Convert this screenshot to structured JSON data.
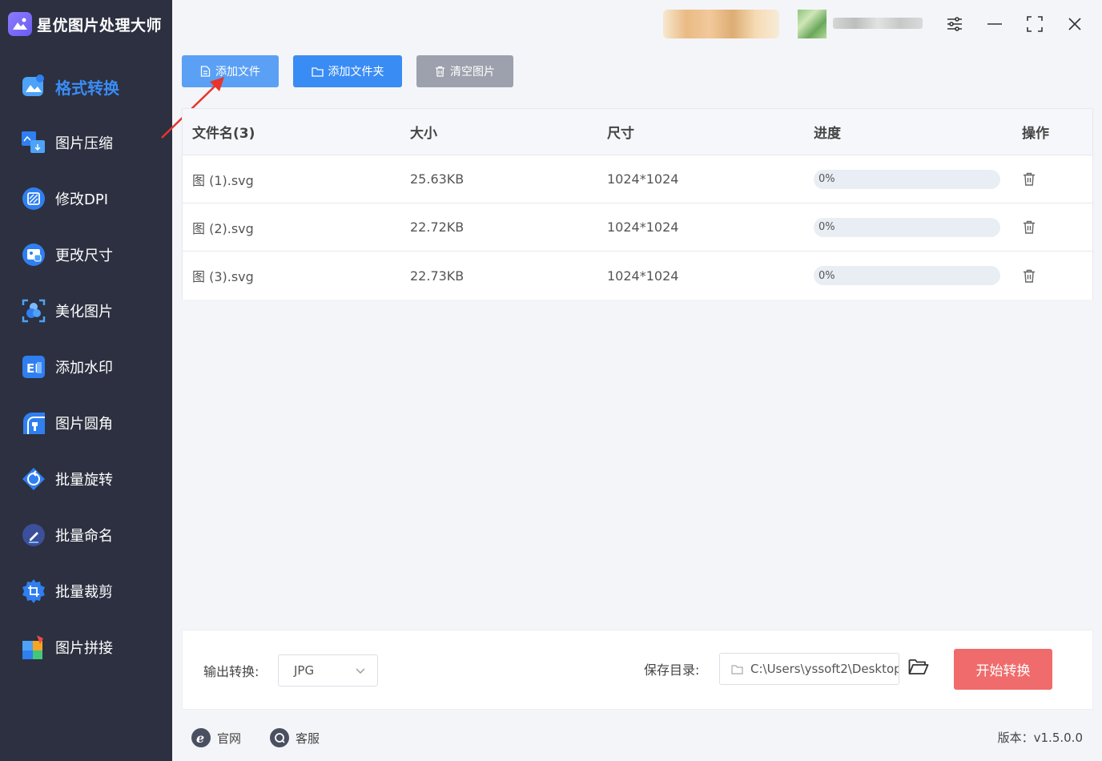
{
  "app": {
    "title": "星优图片处理大师"
  },
  "sidebar": {
    "items": [
      {
        "label": "格式转换",
        "icon": "image-convert-icon",
        "active": true
      },
      {
        "label": "图片压缩",
        "icon": "image-compress-icon"
      },
      {
        "label": "修改DPI",
        "icon": "dpi-icon"
      },
      {
        "label": "更改尺寸",
        "icon": "resize-icon"
      },
      {
        "label": "美化图片",
        "icon": "beautify-icon"
      },
      {
        "label": "添加水印",
        "icon": "watermark-icon"
      },
      {
        "label": "图片圆角",
        "icon": "rounded-corner-icon"
      },
      {
        "label": "批量旋转",
        "icon": "rotate-icon"
      },
      {
        "label": "批量命名",
        "icon": "rename-icon"
      },
      {
        "label": "批量裁剪",
        "icon": "crop-icon"
      },
      {
        "label": "图片拼接",
        "icon": "puzzle-icon"
      }
    ]
  },
  "toolbar": {
    "add_file": "添加文件",
    "add_folder": "添加文件夹",
    "clear": "清空图片"
  },
  "table": {
    "headers": {
      "name": "文件名(3)",
      "size": "大小",
      "dimension": "尺寸",
      "progress": "进度",
      "action": "操作"
    },
    "rows": [
      {
        "name": "图 (1).svg",
        "size": "25.63KB",
        "dimension": "1024*1024",
        "progress": "0%"
      },
      {
        "name": "图 (2).svg",
        "size": "22.72KB",
        "dimension": "1024*1024",
        "progress": "0%"
      },
      {
        "name": "图 (3).svg",
        "size": "22.73KB",
        "dimension": "1024*1024",
        "progress": "0%"
      }
    ]
  },
  "bottom": {
    "output_label": "输出转换:",
    "format_value": "JPG",
    "save_label": "保存目录:",
    "save_path": "C:\\Users\\yssoft2\\Desktop",
    "start_button": "开始转换"
  },
  "footer": {
    "website": "官网",
    "support": "客服",
    "version": "版本：v1.5.0.0"
  },
  "colors": {
    "sidebar_bg": "#2c3040",
    "accent_blue": "#3a8cf5",
    "start_red": "#f06b6b",
    "clear_gray": "#9ca1ad"
  }
}
